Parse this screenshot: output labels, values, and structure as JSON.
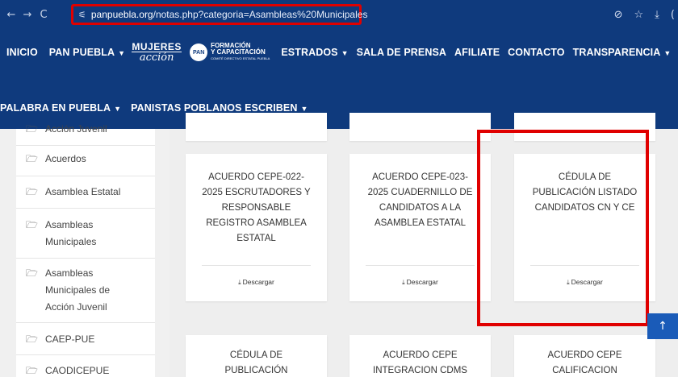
{
  "browser": {
    "back": "←",
    "forward": "→",
    "reload": "C",
    "site_info_icon": "⚟",
    "url_host": "panpuebla.org",
    "url_path": "/notas.php?categoria=Asambleas%20Municipales",
    "icons": {
      "lens": "⊘",
      "star": "☆",
      "download": "⤓",
      "extra": "("
    }
  },
  "nav": {
    "row1": [
      {
        "label": "INICIO",
        "caret": false
      },
      {
        "label": "PAN PUEBLA",
        "caret": true
      }
    ],
    "logo_mujeres": {
      "line1": "MUJERES",
      "line2": "acción"
    },
    "logo_formacion": {
      "pan": "PAN",
      "line1": "FORMACIÓN",
      "line2": "Y CAPACITACIÓN",
      "line3": "COMITÉ DIRECTIVO ESTATAL PUEBLA"
    },
    "row1b": [
      {
        "label": "ESTRADOS",
        "caret": true
      },
      {
        "label": "SALA DE PRENSA",
        "caret": false
      },
      {
        "label": "AFILIATE",
        "caret": false
      },
      {
        "label": "CONTACTO",
        "caret": false
      },
      {
        "label": "TRANSPARENCIA",
        "caret": true
      }
    ],
    "row2": [
      {
        "label": "PALABRA EN PUEBLA",
        "caret": true
      },
      {
        "label": "PANISTAS POBLANOS ESCRIBEN",
        "caret": true
      }
    ],
    "caret_glyph": "▼"
  },
  "sidebar": {
    "folder_icon": "🗁",
    "items": [
      {
        "lines": [
          "Acción Juvenil"
        ]
      },
      {
        "lines": [
          "Acuerdos"
        ]
      },
      {
        "lines": [
          "Asamblea Estatal"
        ]
      },
      {
        "lines": [
          "Asambleas",
          "Municipales"
        ]
      },
      {
        "lines": [
          "Asambleas",
          "Municipales de",
          "Acción Juvenil"
        ]
      },
      {
        "lines": [
          "CAEP-PUE"
        ]
      },
      {
        "lines": [
          "CAODICEPUE"
        ]
      }
    ]
  },
  "cards": {
    "download_label": "Descargar",
    "download_icon": "⤓",
    "items": [
      {
        "lines": [
          "ACUERDO CEPE-022-",
          "2025 ESCRUTADORES Y",
          "RESPONSABLE",
          "REGISTRO ASAMBLEA",
          "ESTATAL"
        ]
      },
      {
        "lines": [
          "ACUERDO CEPE-023-",
          "2025 CUADERNILLO DE",
          "CANDIDATOS A LA",
          "ASAMBLEA ESTATAL"
        ]
      },
      {
        "lines": [
          "CÉDULA DE",
          "PUBLICACIÓN LISTADO",
          "CANDIDATOS CN Y CE"
        ]
      },
      {
        "lines": [
          "CÉDULA DE",
          "PUBLICACIÓN"
        ]
      },
      {
        "lines": [
          "ACUERDO CEPE",
          "INTEGRACION CDMS"
        ]
      },
      {
        "lines": [
          "ACUERDO CEPE",
          "CALIFICACION"
        ]
      }
    ]
  },
  "scroll_top": {
    "label": "↑"
  },
  "colors": {
    "header_bg": "#0f3a7d",
    "highlight": "#e00000",
    "scroll_btn": "#1a5bb8"
  }
}
